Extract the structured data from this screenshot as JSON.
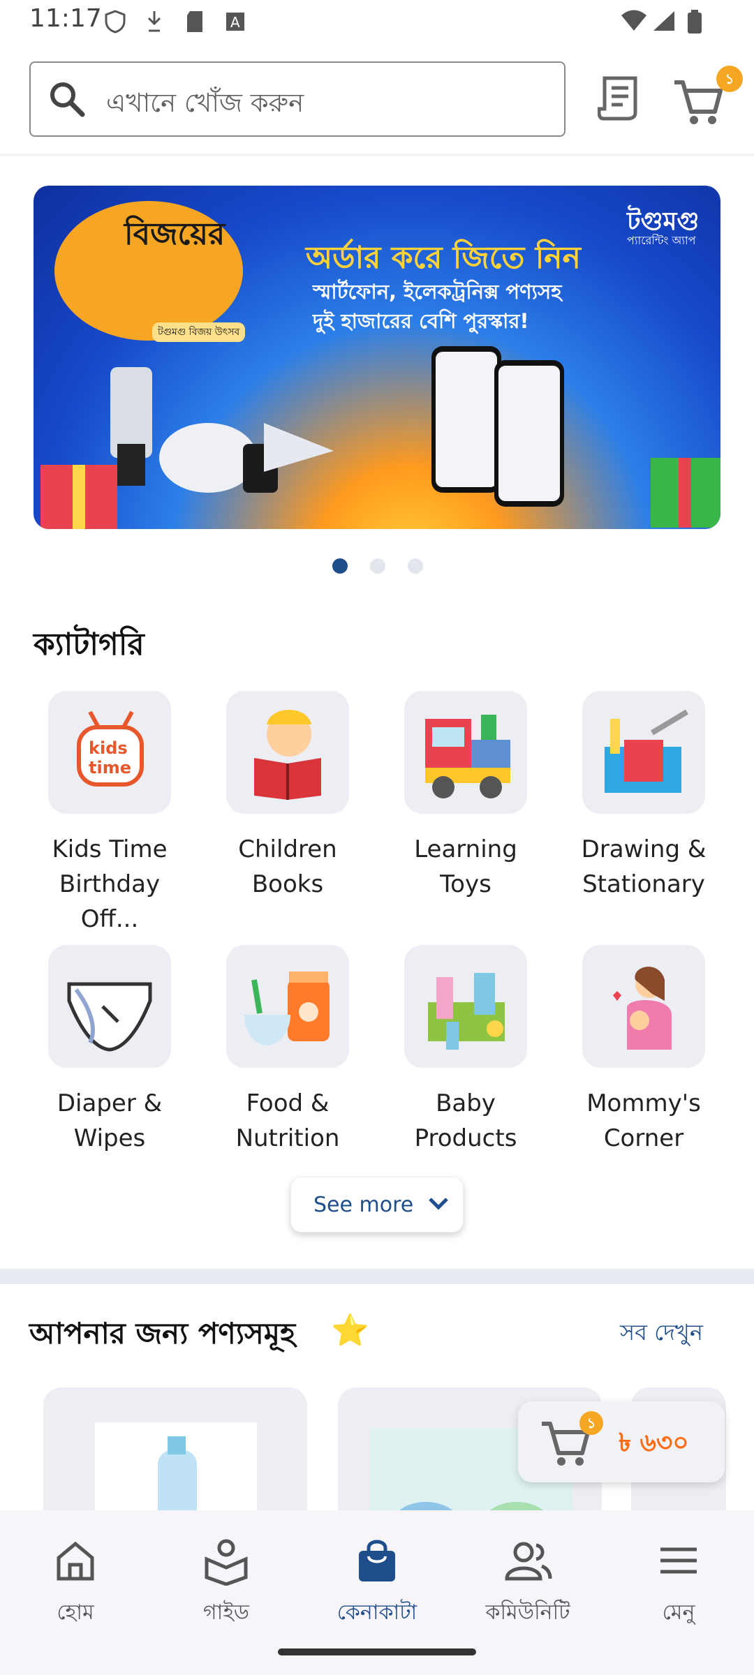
{
  "status_bar": {
    "time": "11:17"
  },
  "search": {
    "placeholder": "এখানে খোঁজ করুন"
  },
  "header": {
    "cart_count": "১"
  },
  "banner": {
    "badge_title": "বিজয়ের",
    "badge_subtitle": "টগুমগু বিজয় উৎসব",
    "headline": "অর্ডার করে জিতে নিন",
    "line2": "স্মার্টফোন, ইলেকট্রনিক্স পণ্যসহ",
    "line3": "দুই হাজারের বেশি পুরস্কার!",
    "brand": "টগুমগু",
    "brand_sub": "প্যারেন্টিং অ্যাপ",
    "pages": 3,
    "active_page": 1
  },
  "categories": {
    "title": "ক্যাটাগরি",
    "items": [
      {
        "line1": "Kids Time",
        "line2": "Birthday Off...",
        "icon": "kids-time-icon"
      },
      {
        "line1": "Children",
        "line2": "Books",
        "icon": "children-books-icon"
      },
      {
        "line1": "Learning",
        "line2": "Toys",
        "icon": "toy-train-icon"
      },
      {
        "line1": "Drawing &",
        "line2": "Stationary",
        "icon": "stationary-icon"
      },
      {
        "line1": "Diaper &",
        "line2": "Wipes",
        "icon": "diaper-icon"
      },
      {
        "line1": "Food &",
        "line2": "Nutrition",
        "icon": "baby-food-icon"
      },
      {
        "line1": "Baby",
        "line2": "Products",
        "icon": "baby-products-icon"
      },
      {
        "line1": "Mommy's",
        "line2": "Corner",
        "icon": "mother-baby-icon"
      }
    ],
    "see_more": "See more"
  },
  "recommended": {
    "title": "আপনার জন্য পণ্যসমূহ",
    "star": "⭐",
    "see_all": "সব দেখুন"
  },
  "floating_cart": {
    "count": "১",
    "amount": "৳ ৬৩০"
  },
  "bottom_nav": {
    "items": [
      {
        "label": "হোম",
        "icon": "home-icon",
        "active": false
      },
      {
        "label": "গাইড",
        "icon": "guide-icon",
        "active": false
      },
      {
        "label": "কেনাকাটা",
        "icon": "shopping-bag-icon",
        "active": true
      },
      {
        "label": "কমিউনিটি",
        "icon": "community-icon",
        "active": false
      },
      {
        "label": "মেনু",
        "icon": "menu-icon",
        "active": false
      }
    ]
  },
  "colors": {
    "accent": "#1f4e8c",
    "badge": "#f5a623",
    "price": "#ff6a13"
  }
}
